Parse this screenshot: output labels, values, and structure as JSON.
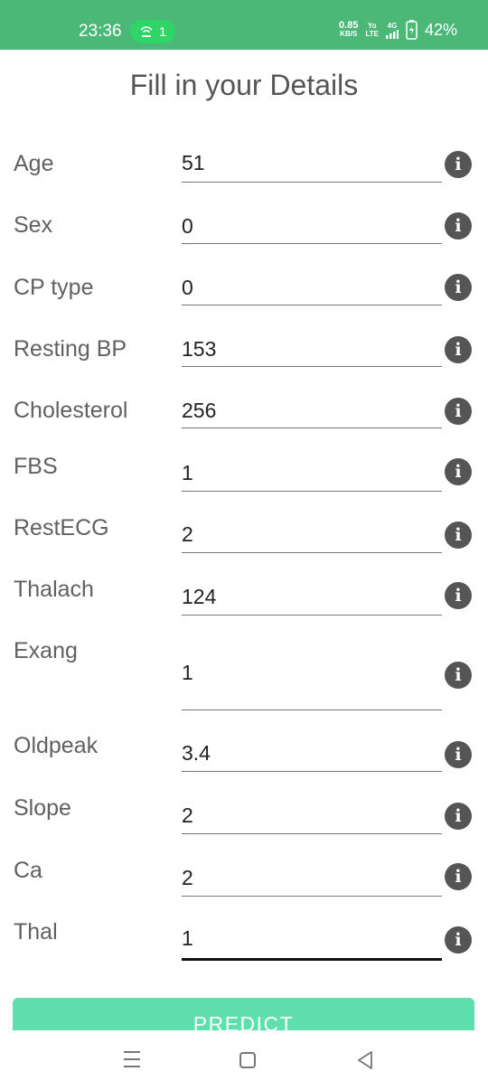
{
  "status_bar": {
    "time": "23:36",
    "hotspot_count": "1",
    "net_speed": "0.85",
    "net_speed_unit": "KB/S",
    "volte_top": "Yo",
    "volte_bottom": "LTE",
    "network_type": "4G",
    "battery": "42%"
  },
  "page": {
    "title": "Fill in your Details"
  },
  "fields": [
    {
      "label": "Age",
      "value": "51"
    },
    {
      "label": "Sex",
      "value": "0"
    },
    {
      "label": "CP type",
      "value": "0"
    },
    {
      "label": "Resting BP",
      "value": "153"
    },
    {
      "label": "Cholesterol",
      "value": "256"
    },
    {
      "label": "FBS",
      "value": "1"
    },
    {
      "label": "RestECG",
      "value": "2"
    },
    {
      "label": "Thalach",
      "value": "124"
    },
    {
      "label": "Exang",
      "value": "1"
    },
    {
      "label": "Oldpeak",
      "value": "3.4"
    },
    {
      "label": "Slope",
      "value": "2"
    },
    {
      "label": "Ca",
      "value": "2"
    },
    {
      "label": "Thal",
      "value": "1"
    }
  ],
  "info_icon_glyph": "i",
  "predict_button": {
    "label": "PREDICT"
  },
  "colors": {
    "status_bar": "#4cb877",
    "predict_button": "#5edfad",
    "info_icon": "#555555"
  },
  "icons": [
    "hotspot-icon",
    "signal-icon",
    "battery-icon",
    "info-icon",
    "menu-icon",
    "home-icon",
    "back-icon"
  ]
}
